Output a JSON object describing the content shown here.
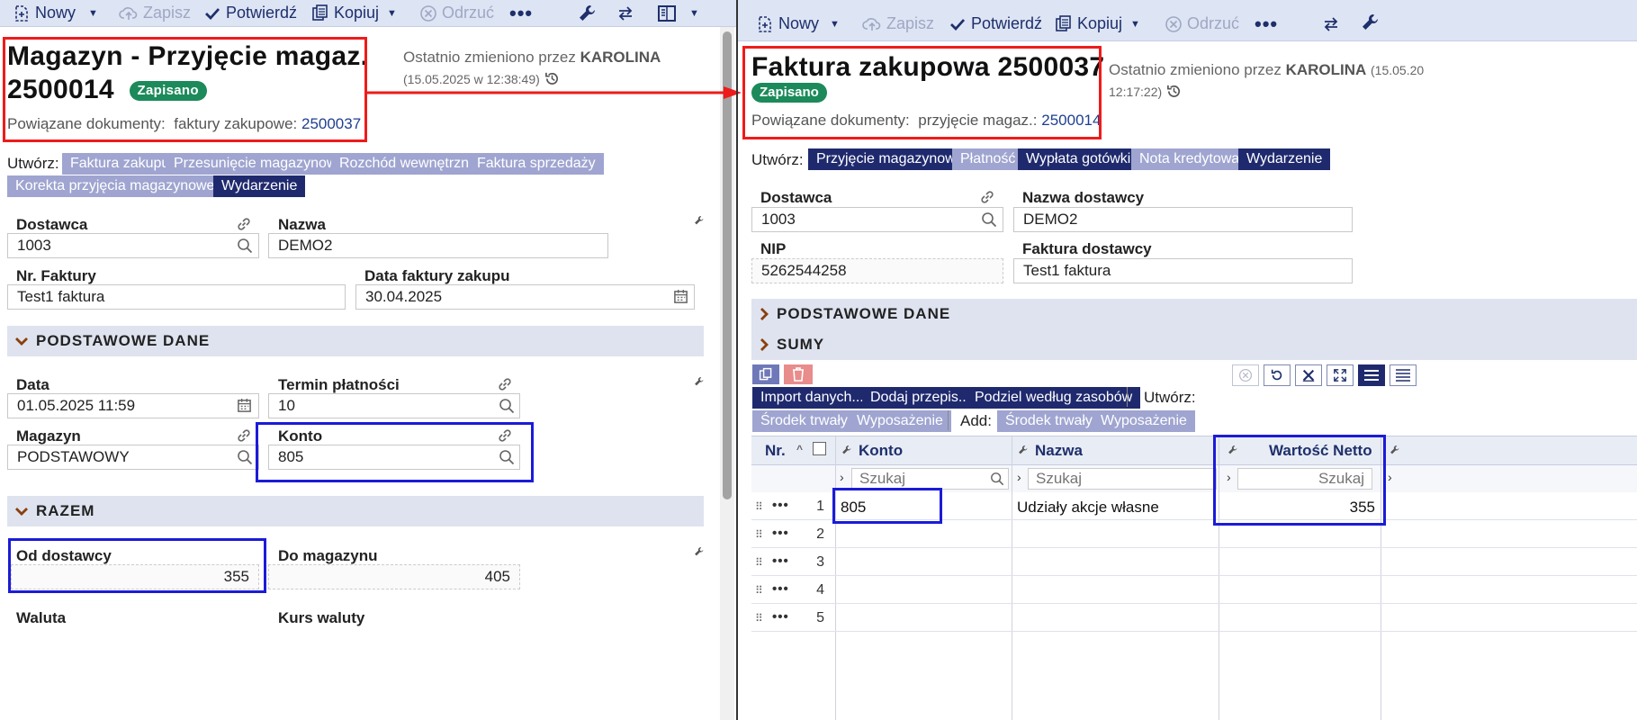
{
  "toolbar": {
    "new": "Nowy",
    "save": "Zapisz",
    "confirm": "Potwierdź",
    "copy": "Kopiuj",
    "discard": "Odrzuć"
  },
  "left": {
    "title_line1": "Magazyn - Przyjęcie magaz.",
    "title_line2": "2500014",
    "status": "Zapisano",
    "changed_by_label": "Ostatnio zmieniono przez",
    "changed_by_user": "KAROLINA",
    "changed_at": "(15.05.2025 w 12:38:49)",
    "related_label": "Powiązane dokumenty:",
    "related_type": "faktury zakupowe:",
    "related_link": "2500037",
    "create_label": "Utwórz:",
    "create_buttons": [
      "Faktura zakupu",
      "Przesunięcie magazynowe",
      "Rozchód wewnętrzny",
      "Faktura sprzedaży",
      "Korekta przyjęcia magazynowego",
      "Wydarzenie"
    ],
    "supplier_label": "Dostawca",
    "supplier_value": "1003",
    "name_label": "Nazwa",
    "name_value": "DEMO2",
    "invoice_no_label": "Nr. Faktury",
    "invoice_no_value": "Test1 faktura",
    "invoice_date_label": "Data faktury zakupu",
    "invoice_date_value": "30.04.2025",
    "section_basic": "PODSTAWOWE DANE",
    "date_label": "Data",
    "date_value": "01.05.2025 11:59",
    "due_label": "Termin płatności",
    "due_value": "10",
    "warehouse_label": "Magazyn",
    "warehouse_value": "PODSTAWOWY",
    "account_label": "Konto",
    "account_value": "805",
    "section_total": "RAZEM",
    "from_supplier_label": "Od dostawcy",
    "from_supplier_value": "355",
    "to_warehouse_label": "Do magazynu",
    "to_warehouse_value": "405",
    "currency_label": "Waluta",
    "rate_label": "Kurs waluty"
  },
  "right": {
    "title": "Faktura zakupowa 2500037",
    "status": "Zapisano",
    "changed_by_label": "Ostatnio zmieniono przez",
    "changed_by_user": "KAROLINA",
    "changed_at_part1": "(15.05.20",
    "changed_at_part2": "12:17:22)",
    "related_label": "Powiązane dokumenty:",
    "related_type": "przyjęcie magaz.:",
    "related_link": "2500014",
    "create_label": "Utwórz:",
    "create_buttons": [
      "Przyjęcie magazynowe",
      "Płatność",
      "Wypłata gotówki",
      "Nota kredytowa",
      "Wydarzenie"
    ],
    "supplier_label": "Dostawca",
    "supplier_value": "1003",
    "supplier_name_label": "Nazwa dostawcy",
    "supplier_name_value": "DEMO2",
    "nip_label": "NIP",
    "nip_value": "5262544258",
    "supplier_invoice_label": "Faktura dostawcy",
    "supplier_invoice_value": "Test1 faktura",
    "section_basic": "PODSTAWOWE DANE",
    "section_sums": "SUMY",
    "grid_buttons": [
      "Import danych...",
      "Dodaj przepis...",
      "Podziel według zasobów"
    ],
    "grid_create_label": "Utwórz:",
    "grid_light1": "Środek trwały",
    "grid_light2": "Wyposażenie",
    "grid_add_label": "Add:",
    "grid_light3": "Środek trwały",
    "grid_light4": "Wyposażenie",
    "columns": {
      "nr": "Nr.",
      "account": "Konto",
      "name": "Nazwa",
      "net": "Wartość Netto"
    },
    "search_placeholder": "Szukaj",
    "rows": [
      {
        "nr": "1",
        "account": "805",
        "name": "Udziały akcje własne",
        "net": "355"
      },
      {
        "nr": "2",
        "account": "",
        "name": "",
        "net": ""
      },
      {
        "nr": "3",
        "account": "",
        "name": "",
        "net": ""
      },
      {
        "nr": "4",
        "account": "",
        "name": "",
        "net": ""
      },
      {
        "nr": "5",
        "account": "",
        "name": "",
        "net": ""
      }
    ]
  },
  "colors": {
    "dark_button": "#1f2a6e",
    "light_button": "#9fa5d0",
    "status_green": "#1c8a5a",
    "highlight_red": "#ee1b1b",
    "highlight_blue": "#1b1bd8"
  }
}
